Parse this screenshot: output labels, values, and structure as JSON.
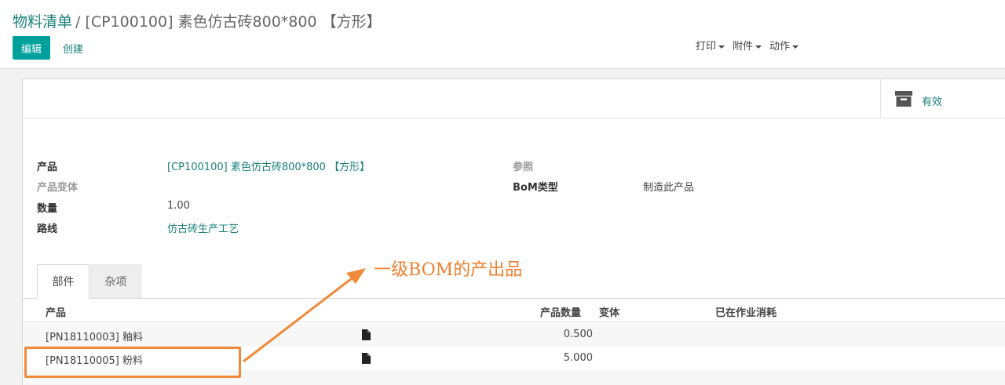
{
  "breadcrumb": {
    "parent": "物料清单",
    "separator": "/",
    "current": "[CP100100] 素色仿古砖800*800 【方形】"
  },
  "buttons": {
    "edit": "编辑",
    "create": "创建"
  },
  "sidebar": {
    "print": "打印",
    "attachment": "附件",
    "action": "动作"
  },
  "stat_button": {
    "icon": "archive-icon",
    "label": "有效"
  },
  "fields": {
    "product_label": "产品",
    "product_value": "[CP100100] 素色仿古砖800*800 【方形】",
    "variant_label": "产品变体",
    "quantity_label": "数量",
    "quantity_value": "1.00",
    "route_label": "路线",
    "route_value": "仿古砖生产工艺",
    "reference_label": "参照",
    "bom_type_label": "BoM类型",
    "bom_type_value": "制造此产品"
  },
  "tabs": [
    {
      "label": "部件",
      "active": true
    },
    {
      "label": "杂项",
      "active": false
    }
  ],
  "table": {
    "columns": [
      "产品",
      "产品数量",
      "变体",
      "已在作业消耗"
    ],
    "rows": [
      {
        "product": "[PN18110003] 釉料",
        "qty": "0.500"
      },
      {
        "product": "[PN18110005] 粉料",
        "qty": "5.000"
      }
    ]
  },
  "annotation": {
    "text": "一级BOM的产出品",
    "color": "#ef7f2e"
  },
  "colors": {
    "primary": "#00a09d",
    "link": "#1b8179",
    "annotation": "#f08a3a"
  }
}
